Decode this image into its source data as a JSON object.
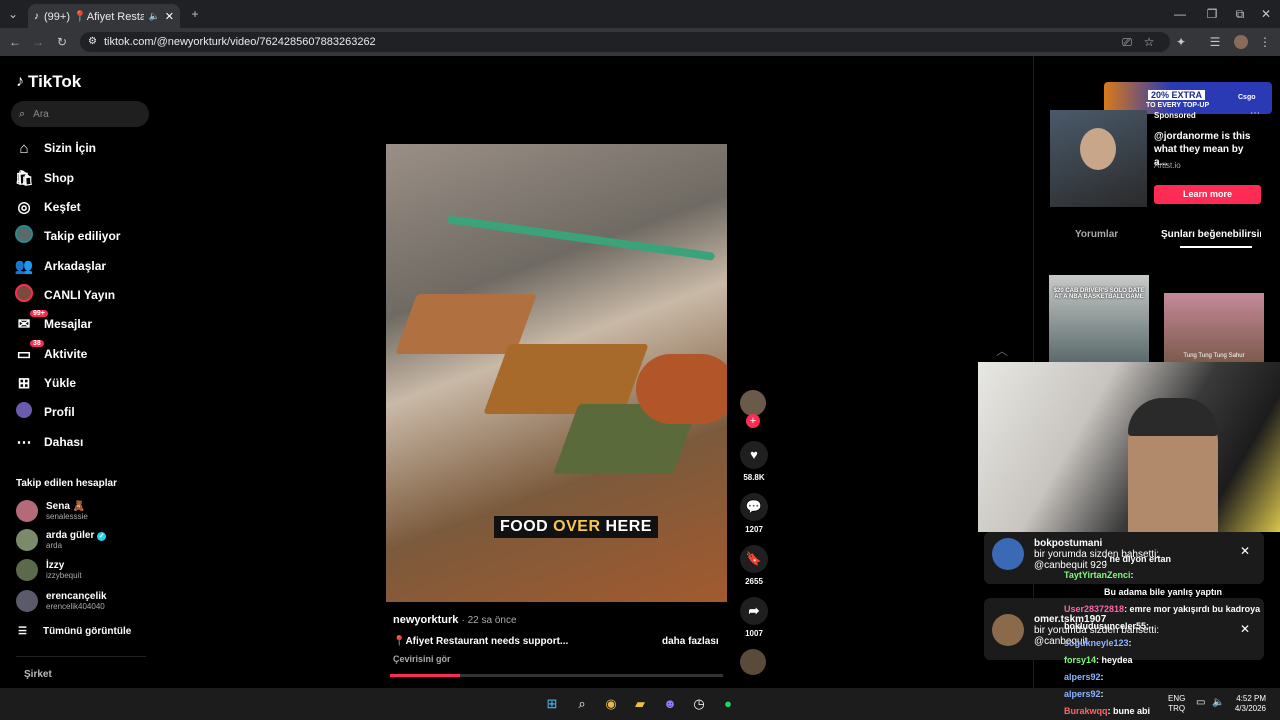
{
  "browser": {
    "tab_title": "(99+) 📍Afiyet Restaurant n",
    "url": "tiktok.com/@newyorkturk/video/7624285607883263262"
  },
  "sidebar": {
    "logo": "TikTok",
    "search_placeholder": "Ara",
    "nav": [
      {
        "label": "Sizin İçin",
        "icon": "home-icon"
      },
      {
        "label": "Shop",
        "icon": "shop-icon"
      },
      {
        "label": "Keşfet",
        "icon": "compass-icon"
      },
      {
        "label": "Takip ediliyor",
        "icon": "following-icon"
      },
      {
        "label": "Arkadaşlar",
        "icon": "friends-icon"
      },
      {
        "label": "CANLI Yayın",
        "icon": "live-icon"
      },
      {
        "label": "Mesajlar",
        "icon": "messages-icon",
        "badge": "99+"
      },
      {
        "label": "Aktivite",
        "icon": "activity-icon",
        "badge": "38"
      },
      {
        "label": "Yükle",
        "icon": "upload-icon"
      },
      {
        "label": "Profil",
        "icon": "profile-icon"
      },
      {
        "label": "Dahası",
        "icon": "more-icon"
      }
    ],
    "followed_title": "Takip edilen hesaplar",
    "accounts": [
      {
        "name": "Sena 🧸",
        "user": "senalesssie"
      },
      {
        "name": "arda güler",
        "user": "arda"
      },
      {
        "name": "İzzy",
        "user": "izzybequit"
      },
      {
        "name": "erencançelik",
        "user": "erencelik404040"
      }
    ],
    "see_all": "Tümünü görüntüle",
    "company": "Şirket"
  },
  "video": {
    "overlay_caption_a": "FOOD ",
    "overlay_caption_b": "OVER",
    "overlay_caption_c": " HERE",
    "author": "newyorkturk",
    "time": "· 22 sa önce",
    "description": "📍Afiyet Restaurant needs support...",
    "more": "daha fazlası",
    "translate": "Çevirisini gör",
    "progress": 0.21
  },
  "actions": {
    "likes": "58.8K",
    "comments": "1207",
    "saves": "2655",
    "shares": "1007"
  },
  "right_panel": {
    "ad_banner": "20% EXTRA",
    "ad_banner_sub": "TO EVERY TOP-UP",
    "ad_brand": "Csgo",
    "sponsored": "Sponsored",
    "ad_text": "@jordanorme is this what they mean by a...",
    "ad_domain": "Artist.io",
    "ad_button": "Learn more",
    "tab_comments": "Yorumlar",
    "tab_suggested": "Şunları beğenebilirsin",
    "thumb1_text": "$20 CAB DRIVER'S SOLO DATE AT A NBA BASKETBALL GAME",
    "thumb2_text": "Tung Tung Tung Sahur"
  },
  "notifications": [
    {
      "user": "bokpostumani",
      "line1": "bir yorumda sizden bahsetti:",
      "line2": "@canbequit 929"
    },
    {
      "user": "omer.tskm1907",
      "line1": "bir yorumda sizden bahsetti:",
      "line2": "@canbequit"
    }
  ],
  "chat": [
    {
      "user": "TaytYirtanZenci",
      "msg": ":",
      "color": "#7cfc7c"
    },
    {
      "user": "User28372818",
      "msg": ": emre mor yakışırdı bu kadroya",
      "color": "#ff66aa"
    },
    {
      "user": "bokludusunceler55",
      "msg": ":",
      "color": "#ffffff"
    },
    {
      "user": "sogukneyle123",
      "msg": ":",
      "color": "#8ab4ff"
    },
    {
      "user": "forsy14",
      "msg": ": heydea",
      "color": "#7cfc7c"
    },
    {
      "user": "alpers92",
      "msg": ":",
      "color": "#8ab4ff"
    },
    {
      "user": "alpers92",
      "msg": ":",
      "color": "#8ab4ff"
    },
    {
      "user": "Burakwqq",
      "msg": ": bune abi",
      "color": "#ff6666"
    }
  ],
  "chat_other": [
    ": ne diyon ertan",
    "Bu adama bile yanlış yaptın"
  ],
  "taskbar": {
    "lang1": "ENG",
    "lang2": "TRQ",
    "time": "4:52 PM",
    "date": "4/3/2026"
  }
}
